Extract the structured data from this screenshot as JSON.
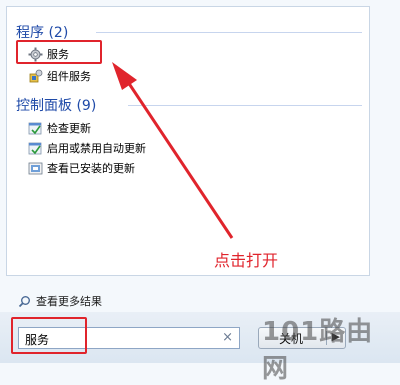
{
  "programs": {
    "title": "程序 (2)",
    "items": [
      {
        "label": "服务",
        "icon": "gear-icon"
      },
      {
        "label": "组件服务",
        "icon": "component-services-icon"
      }
    ]
  },
  "control_panel": {
    "title": "控制面板 (9)",
    "items": [
      {
        "label": "检查更新",
        "icon": "update-icon"
      },
      {
        "label": "启用或禁用自动更新",
        "icon": "update-icon"
      },
      {
        "label": "查看已安装的更新",
        "icon": "installed-updates-icon"
      }
    ]
  },
  "search_more": {
    "label": "查看更多结果",
    "icon": "search-icon"
  },
  "search": {
    "value": "服务",
    "clear": "×"
  },
  "shutdown": {
    "label": "关机",
    "arrow": "▶"
  },
  "annotation": {
    "text": "点击打开"
  },
  "watermark": {
    "text": "101路由网"
  },
  "colors": {
    "accent_red": "#e0242c",
    "section_blue": "#1f4aa8"
  }
}
